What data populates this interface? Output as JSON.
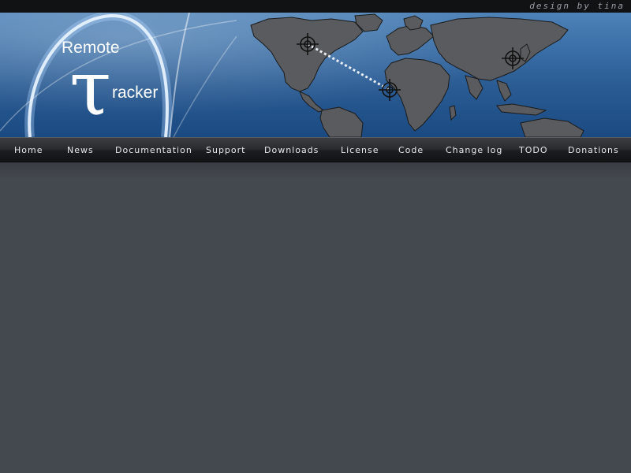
{
  "topbar": {
    "credit": "design by tina"
  },
  "logo": {
    "line1": "Remote",
    "tau": "τ",
    "line2": "racker"
  },
  "nav": {
    "items": [
      {
        "label": "Home"
      },
      {
        "label": "News"
      },
      {
        "label": "Documentation"
      },
      {
        "label": "Support"
      },
      {
        "label": "Downloads"
      },
      {
        "label": "License"
      },
      {
        "label": "Code"
      },
      {
        "label": "Change log"
      },
      {
        "label": "TODO"
      },
      {
        "label": "Donations"
      }
    ]
  },
  "colors": {
    "banner_blue": "#2a5b93",
    "content_bg": "#44484f",
    "topbar_bg": "#111214",
    "nav_text": "#e6e8eb"
  },
  "icons": {
    "target": "crosshair-target-icon",
    "map": "world-map-graphic"
  }
}
